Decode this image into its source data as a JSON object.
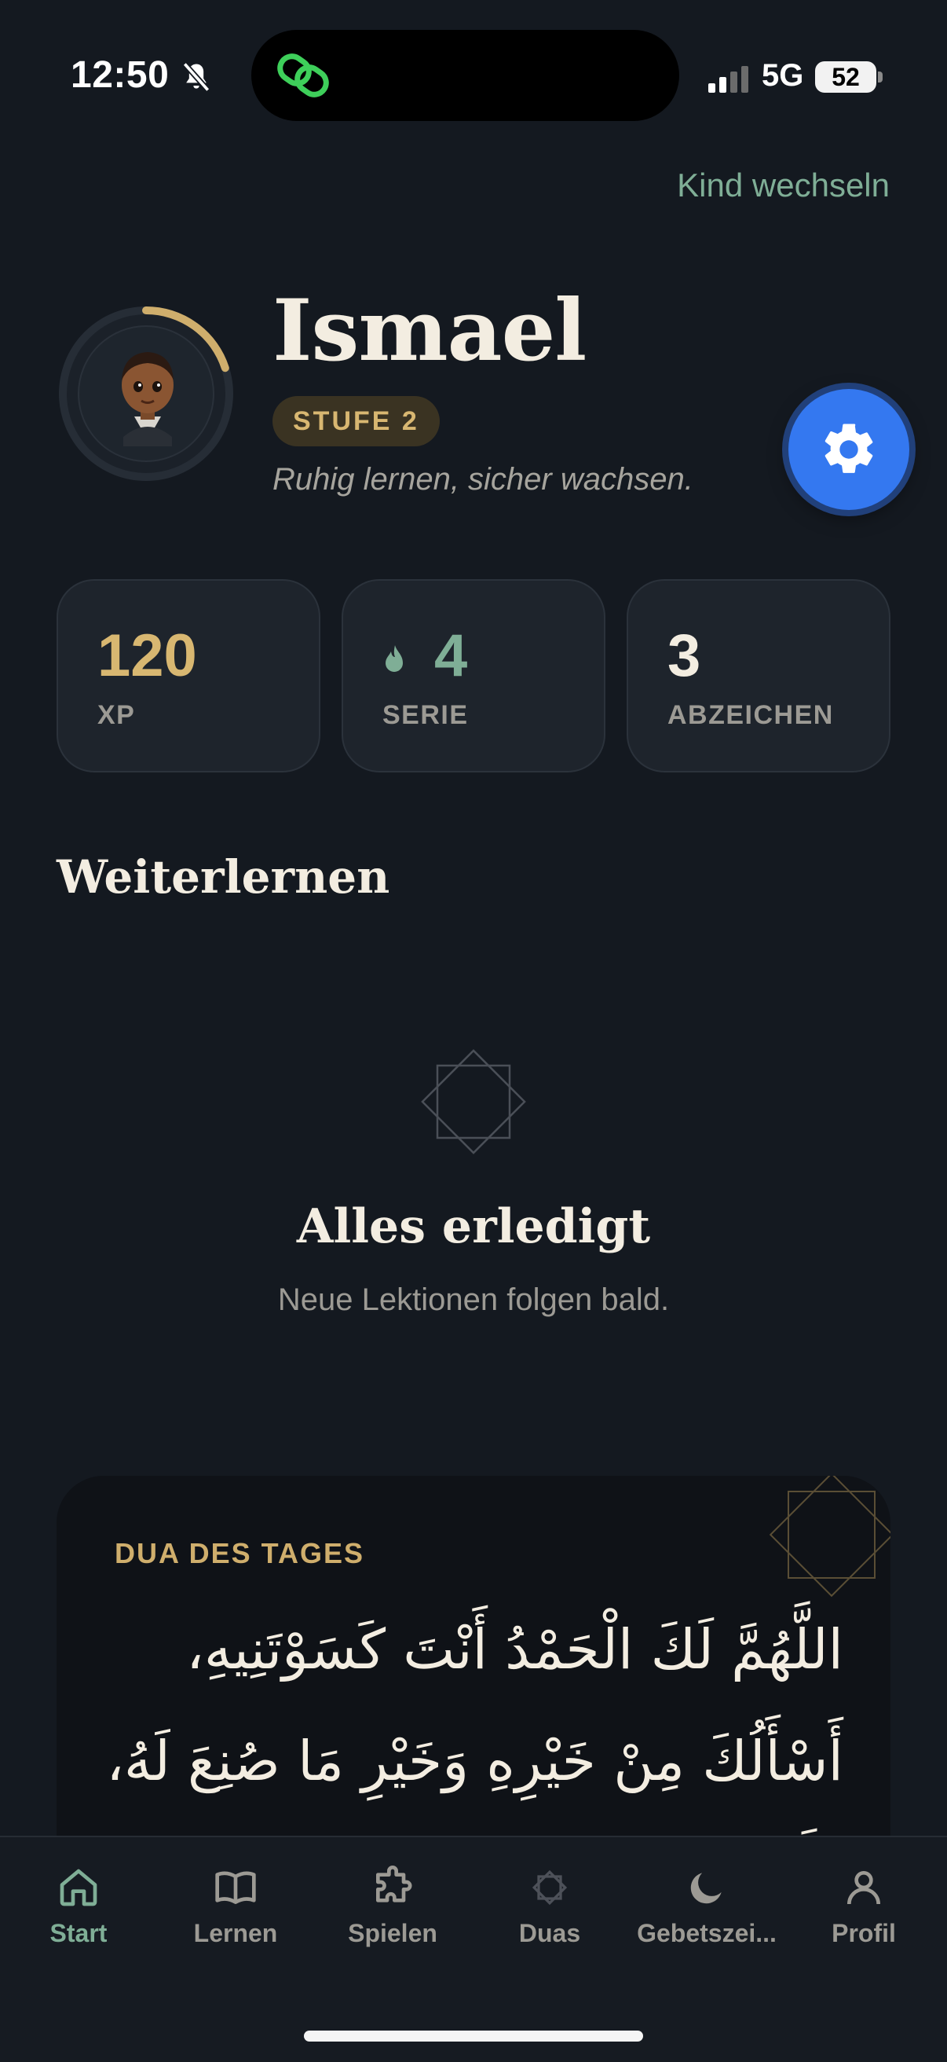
{
  "status_bar": {
    "time": "12:50",
    "network": "5G",
    "battery": "52"
  },
  "header": {
    "switch_child": "Kind wechseln"
  },
  "profile": {
    "name": "Ismael",
    "level": "STUFE 2",
    "tagline": "Ruhig lernen, sicher wachsen.",
    "level_progress": 0.2
  },
  "stats": [
    {
      "value": "120",
      "label": "XP",
      "color": "#d8b771"
    },
    {
      "value": "4",
      "label": "SERIE",
      "color": "#7fae96",
      "icon": "flame-icon"
    },
    {
      "value": "3",
      "label": "ABZEICHEN",
      "color": "#f3ede1"
    }
  ],
  "continue": {
    "title": "Weiterlernen",
    "done_title": "Alles erledigt",
    "done_subtitle": "Neue Lektionen folgen bald."
  },
  "dua": {
    "label": "DUA DES TAGES",
    "text": "اللَّهُمَّ لَكَ الْحَمْدُ أَنْتَ كَسَوْتَنِيهِ، أَسْأَلُكَ مِنْ خَيْرِهِ وَخَيْرِ مَا صُنِعَ لَهُ، وَأَعُوذُ"
  },
  "tabs": [
    {
      "label": "Start",
      "icon": "home-icon",
      "active": true
    },
    {
      "label": "Lernen",
      "icon": "book-icon",
      "active": false
    },
    {
      "label": "Spielen",
      "icon": "puzzle-icon",
      "active": false
    },
    {
      "label": "Duas",
      "icon": "star-octagon-icon",
      "active": false
    },
    {
      "label": "Gebetszei...",
      "icon": "moon-icon",
      "active": false
    },
    {
      "label": "Profil",
      "icon": "user-icon",
      "active": false
    }
  ],
  "colors": {
    "background": "#141920",
    "accent_green": "#7fae96",
    "accent_gold": "#d8b771",
    "settings_blue": "#3478f0"
  }
}
